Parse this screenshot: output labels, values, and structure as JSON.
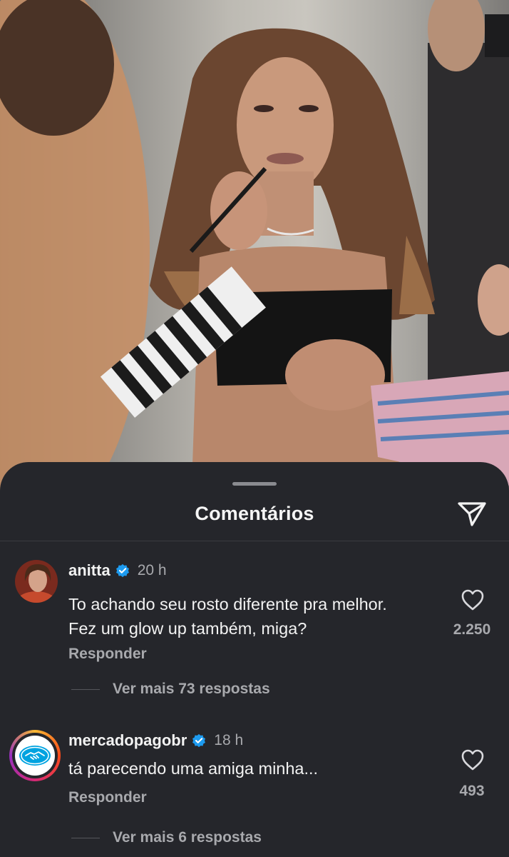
{
  "sheet": {
    "title": "Comentários",
    "share_icon": "paper-plane-icon"
  },
  "comments": [
    {
      "username": "anitta",
      "verified": true,
      "time": "20 h",
      "text": "To achando seu rosto diferente pra melhor.\nFez um glow up também, miga?",
      "likes": "2.250",
      "reply_label": "Responder",
      "view_replies": "Ver mais 73 respostas"
    },
    {
      "username": "mercadopagobr",
      "verified": true,
      "time": "18 h",
      "text": "tá parecendo uma amiga minha...",
      "likes": "493",
      "reply_label": "Responder",
      "view_replies": "Ver mais 6 respostas"
    }
  ],
  "colors": {
    "sheet_bg": "#25262b",
    "verified_blue": "#1d9bf0",
    "muted_text": "#a8a9ad"
  }
}
